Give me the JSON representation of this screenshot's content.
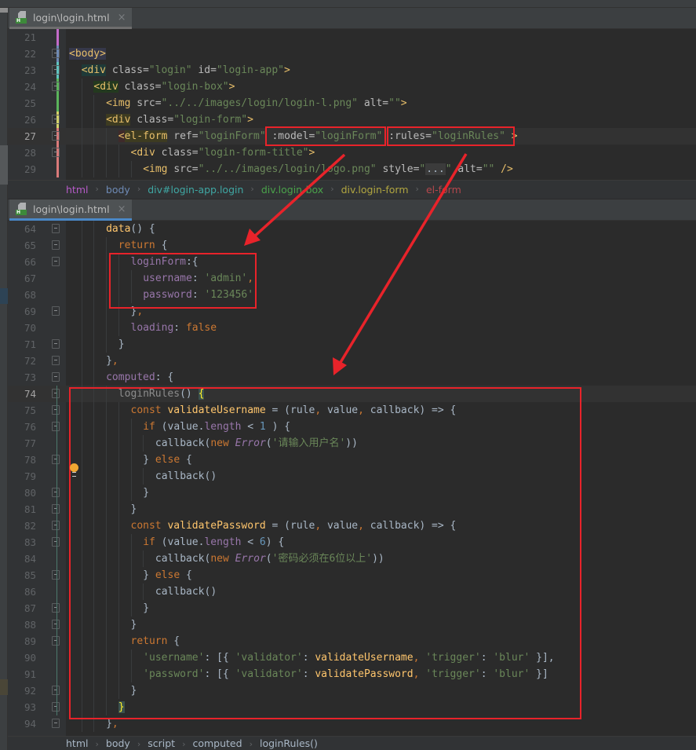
{
  "tabs": {
    "top": {
      "label": "login\\login.html",
      "close": "×",
      "icon_letter": "H"
    },
    "bottom": {
      "label": "login\\login.html",
      "close": "×",
      "icon_letter": "H"
    }
  },
  "top_editor": {
    "lines": [
      {
        "num": "21"
      },
      {
        "num": "22",
        "c": [
          "<body>"
        ]
      },
      {
        "num": "23",
        "c": [
          "<div",
          " class=",
          "\"login\"",
          " id=",
          "\"login-app\"",
          ">"
        ]
      },
      {
        "num": "24",
        "c": [
          "<div",
          " class=",
          "\"login-box\"",
          ">"
        ]
      },
      {
        "num": "25",
        "c": [
          "<img",
          " src=",
          "\"../../images/login/login-l.png\"",
          " alt=",
          "\"\"",
          ">"
        ]
      },
      {
        "num": "26",
        "c": [
          "<div",
          " class=",
          "\"login-form\"",
          ">"
        ]
      },
      {
        "num": "27",
        "c": [
          "<",
          "el-form",
          " ref=",
          "\"loginForm\"",
          " :model=",
          "\"loginForm\"",
          " :rules=",
          "\"loginRules\"",
          " >"
        ]
      },
      {
        "num": "28",
        "c": [
          "<div",
          " class=",
          "\"login-form-title\"",
          ">"
        ]
      },
      {
        "num": "29",
        "c": [
          "<img",
          " src=",
          "\"../../images/login/logo.png\"",
          " style=",
          "\"",
          "...",
          "\"",
          " alt=",
          "\"\"",
          " />"
        ]
      }
    ]
  },
  "top_breadcrumb": [
    "html",
    "body",
    "div#login-app.login",
    "div.login-box",
    "div.login-form",
    "el-form"
  ],
  "bottom_editor": {
    "lines": [
      {
        "num": "64",
        "c": [
          "data",
          "() {"
        ]
      },
      {
        "num": "65",
        "c": [
          "return",
          " {"
        ]
      },
      {
        "num": "66",
        "c": [
          "loginForm",
          ":{"
        ]
      },
      {
        "num": "67",
        "c": [
          "username",
          ": ",
          "'admin'",
          ","
        ]
      },
      {
        "num": "68",
        "c": [
          "password",
          ": ",
          "'123456'"
        ]
      },
      {
        "num": "69",
        "c": [
          "}",
          ","
        ]
      },
      {
        "num": "70",
        "c": [
          "loading",
          ": ",
          "false"
        ]
      },
      {
        "num": "71",
        "c": [
          "}"
        ]
      },
      {
        "num": "72",
        "c": [
          "}",
          ","
        ]
      },
      {
        "num": "73",
        "c": [
          "computed",
          ": {"
        ]
      },
      {
        "num": "74",
        "c": [
          "loginRules",
          "() ",
          "{"
        ]
      },
      {
        "num": "75",
        "c": [
          "const",
          " ",
          "validateUsername",
          " = (rule",
          ",",
          " value",
          ",",
          " callback) => {"
        ]
      },
      {
        "num": "76",
        "c": [
          "if",
          " (value.",
          "length",
          " < ",
          "1",
          " ) {"
        ]
      },
      {
        "num": "77",
        "c": [
          "callback(",
          "new",
          " ",
          "Error",
          "(",
          "'请输入用户名'",
          "))"
        ]
      },
      {
        "num": "78",
        "c": [
          "} ",
          "else",
          " {"
        ]
      },
      {
        "num": "79",
        "c": [
          "callback()"
        ]
      },
      {
        "num": "80",
        "c": [
          "}"
        ]
      },
      {
        "num": "81",
        "c": [
          "}"
        ]
      },
      {
        "num": "82",
        "c": [
          "const",
          " ",
          "validatePassword",
          " = (rule",
          ",",
          " value",
          ",",
          " callback) => {"
        ]
      },
      {
        "num": "83",
        "c": [
          "if",
          " (value.",
          "length",
          " < ",
          "6",
          ") {"
        ]
      },
      {
        "num": "84",
        "c": [
          "callback(",
          "new",
          " ",
          "Error",
          "(",
          "'密码必须在6位以上'",
          "))"
        ]
      },
      {
        "num": "85",
        "c": [
          "} ",
          "else",
          " {"
        ]
      },
      {
        "num": "86",
        "c": [
          "callback()"
        ]
      },
      {
        "num": "87",
        "c": [
          "}"
        ]
      },
      {
        "num": "88",
        "c": [
          "}"
        ]
      },
      {
        "num": "89",
        "c": [
          "return",
          " {"
        ]
      },
      {
        "num": "90",
        "c": [
          "'username'",
          ": [{ ",
          "'validator'",
          ": ",
          "validateUsername",
          ",",
          " ",
          "'trigger'",
          ": ",
          "'blur'",
          " }],"
        ]
      },
      {
        "num": "91",
        "c": [
          "'password'",
          ": [{ ",
          "'validator'",
          ": ",
          "validatePassword",
          ",",
          " ",
          "'trigger'",
          ": ",
          "'blur'",
          " }]"
        ]
      },
      {
        "num": "92",
        "c": [
          "}"
        ]
      },
      {
        "num": "93",
        "c": [
          "}"
        ]
      },
      {
        "num": "94",
        "c": [
          "}",
          ","
        ]
      }
    ]
  },
  "bottom_breadcrumb": [
    "html",
    "body",
    "script",
    "computed",
    "loginRules()"
  ],
  "colors": {
    "annotation_red": "#e8232a",
    "tab_accent": "#4a88c7",
    "breadcrumb": [
      "#b65bc9",
      "#6e8ab5",
      "#3fa7a3",
      "#4aa24a",
      "#b1a640",
      "#b4474c"
    ],
    "breadcrumb_bottom": "#a9b7c6"
  }
}
